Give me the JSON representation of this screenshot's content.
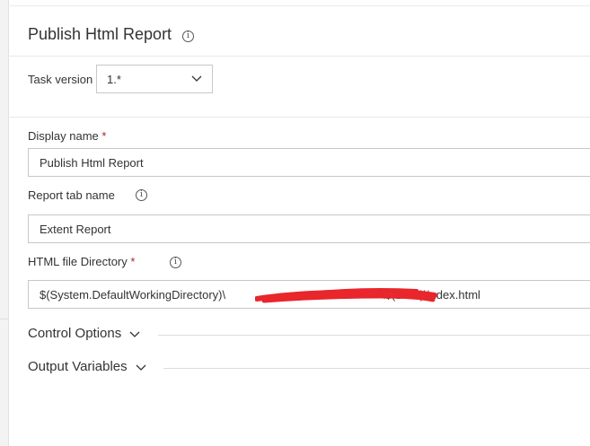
{
  "header": {
    "title": "Publish Html Report",
    "info_icon": "info-icon"
  },
  "task_version": {
    "label": "Task version",
    "value": "1.*",
    "icon": "chevron-down-icon"
  },
  "display_name": {
    "label": "Display name",
    "required_mark": "*",
    "value": "Publish Html Report"
  },
  "report_tab_name": {
    "label": "Report tab name",
    "info_icon": "info-icon",
    "value": "Extent Report"
  },
  "html_file_directory": {
    "label": "HTML file Directory",
    "required_mark": "*",
    "info_icon": "info-icon",
    "value_prefix": "$(System.DefaultWorkingDirectory)\\",
    "value_suffix": "\\$(Date)\\index.html",
    "redaction_color": "#e8262c"
  },
  "sections": {
    "control_options": "Control Options",
    "output_variables": "Output Variables"
  },
  "colors": {
    "required": "#a4262c",
    "border": "#c8c8c8",
    "text": "#333333"
  }
}
